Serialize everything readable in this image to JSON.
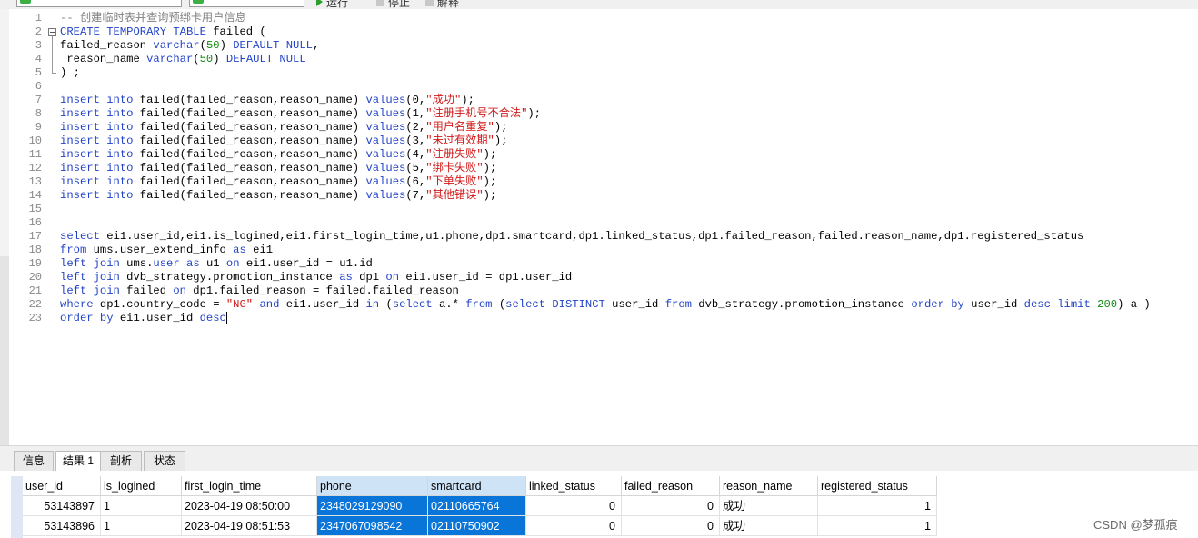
{
  "toolbar": {
    "run_label": "运行",
    "stop_label": "停止",
    "explain_label": "解释"
  },
  "editor": {
    "lines": [
      {
        "n": "1",
        "segs": [
          {
            "t": "-- 创建临时表并查询预绑卡用户信息",
            "c": "c"
          }
        ]
      },
      {
        "n": "2",
        "segs": [
          {
            "t": "CREATE TEMPORARY TABLE",
            "c": "k"
          },
          {
            "t": " failed (",
            "c": ""
          }
        ]
      },
      {
        "n": "3",
        "segs": [
          {
            "t": "failed_reason ",
            "c": ""
          },
          {
            "t": "varchar",
            "c": "k"
          },
          {
            "t": "(",
            "c": ""
          },
          {
            "t": "50",
            "c": "n"
          },
          {
            "t": ") ",
            "c": ""
          },
          {
            "t": "DEFAULT NULL",
            "c": "k"
          },
          {
            "t": ",",
            "c": ""
          }
        ]
      },
      {
        "n": "4",
        "segs": [
          {
            "t": " reason_name ",
            "c": ""
          },
          {
            "t": "varchar",
            "c": "k"
          },
          {
            "t": "(",
            "c": ""
          },
          {
            "t": "50",
            "c": "n"
          },
          {
            "t": ") ",
            "c": ""
          },
          {
            "t": "DEFAULT NULL",
            "c": "k"
          }
        ]
      },
      {
        "n": "5",
        "segs": [
          {
            "t": ") ;",
            "c": ""
          }
        ]
      },
      {
        "n": "6",
        "segs": []
      },
      {
        "n": "7",
        "segs": [
          {
            "t": "insert into",
            "c": "k"
          },
          {
            "t": " failed(failed_reason,reason_name) ",
            "c": ""
          },
          {
            "t": "values",
            "c": "k"
          },
          {
            "t": "(0,",
            "c": ""
          },
          {
            "t": "\"成功\"",
            "c": "s"
          },
          {
            "t": ");",
            "c": ""
          }
        ]
      },
      {
        "n": "8",
        "segs": [
          {
            "t": "insert into",
            "c": "k"
          },
          {
            "t": " failed(failed_reason,reason_name) ",
            "c": ""
          },
          {
            "t": "values",
            "c": "k"
          },
          {
            "t": "(1,",
            "c": ""
          },
          {
            "t": "\"注册手机号不合法\"",
            "c": "s"
          },
          {
            "t": ");",
            "c": ""
          }
        ]
      },
      {
        "n": "9",
        "segs": [
          {
            "t": "insert into",
            "c": "k"
          },
          {
            "t": " failed(failed_reason,reason_name) ",
            "c": ""
          },
          {
            "t": "values",
            "c": "k"
          },
          {
            "t": "(2,",
            "c": ""
          },
          {
            "t": "\"用户名重复\"",
            "c": "s"
          },
          {
            "t": ");",
            "c": ""
          }
        ]
      },
      {
        "n": "10",
        "segs": [
          {
            "t": "insert into",
            "c": "k"
          },
          {
            "t": " failed(failed_reason,reason_name) ",
            "c": ""
          },
          {
            "t": "values",
            "c": "k"
          },
          {
            "t": "(3,",
            "c": ""
          },
          {
            "t": "\"未过有效期\"",
            "c": "s"
          },
          {
            "t": ");",
            "c": ""
          }
        ]
      },
      {
        "n": "11",
        "segs": [
          {
            "t": "insert into",
            "c": "k"
          },
          {
            "t": " failed(failed_reason,reason_name) ",
            "c": ""
          },
          {
            "t": "values",
            "c": "k"
          },
          {
            "t": "(4,",
            "c": ""
          },
          {
            "t": "\"注册失败\"",
            "c": "s"
          },
          {
            "t": ");",
            "c": ""
          }
        ]
      },
      {
        "n": "12",
        "segs": [
          {
            "t": "insert into",
            "c": "k"
          },
          {
            "t": " failed(failed_reason,reason_name) ",
            "c": ""
          },
          {
            "t": "values",
            "c": "k"
          },
          {
            "t": "(5,",
            "c": ""
          },
          {
            "t": "\"绑卡失败\"",
            "c": "s"
          },
          {
            "t": ");",
            "c": ""
          }
        ]
      },
      {
        "n": "13",
        "segs": [
          {
            "t": "insert into",
            "c": "k"
          },
          {
            "t": " failed(failed_reason,reason_name) ",
            "c": ""
          },
          {
            "t": "values",
            "c": "k"
          },
          {
            "t": "(6,",
            "c": ""
          },
          {
            "t": "\"下单失败\"",
            "c": "s"
          },
          {
            "t": ");",
            "c": ""
          }
        ]
      },
      {
        "n": "14",
        "segs": [
          {
            "t": "insert into",
            "c": "k"
          },
          {
            "t": " failed(failed_reason,reason_name) ",
            "c": ""
          },
          {
            "t": "values",
            "c": "k"
          },
          {
            "t": "(7,",
            "c": ""
          },
          {
            "t": "\"其他错误\"",
            "c": "s"
          },
          {
            "t": ");",
            "c": ""
          }
        ]
      },
      {
        "n": "15",
        "segs": []
      },
      {
        "n": "16",
        "segs": []
      },
      {
        "n": "17",
        "segs": [
          {
            "t": "select",
            "c": "k"
          },
          {
            "t": " ei1.user_id,ei1.is_logined,ei1.first_login_time,u1.phone,dp1.smartcard,dp1.linked_status,dp1.failed_reason,failed.reason_name,dp1.registered_status",
            "c": ""
          }
        ]
      },
      {
        "n": "18",
        "segs": [
          {
            "t": "from",
            "c": "k"
          },
          {
            "t": " ums.user_extend_info ",
            "c": ""
          },
          {
            "t": "as",
            "c": "k"
          },
          {
            "t": " ei1",
            "c": ""
          }
        ]
      },
      {
        "n": "19",
        "segs": [
          {
            "t": "left join",
            "c": "k"
          },
          {
            "t": " ums.",
            "c": ""
          },
          {
            "t": "user",
            "c": "k"
          },
          {
            "t": " ",
            "c": ""
          },
          {
            "t": "as",
            "c": "k"
          },
          {
            "t": " u1 ",
            "c": ""
          },
          {
            "t": "on",
            "c": "k"
          },
          {
            "t": " ei1.user_id = u1.id",
            "c": ""
          }
        ]
      },
      {
        "n": "20",
        "segs": [
          {
            "t": "left join",
            "c": "k"
          },
          {
            "t": " dvb_strategy.promotion_instance ",
            "c": ""
          },
          {
            "t": "as",
            "c": "k"
          },
          {
            "t": " dp1 ",
            "c": ""
          },
          {
            "t": "on",
            "c": "k"
          },
          {
            "t": " ei1.user_id = dp1.user_id",
            "c": ""
          }
        ]
      },
      {
        "n": "21",
        "segs": [
          {
            "t": "left join",
            "c": "k"
          },
          {
            "t": " failed ",
            "c": ""
          },
          {
            "t": "on",
            "c": "k"
          },
          {
            "t": " dp1.failed_reason = failed.failed_reason",
            "c": ""
          }
        ]
      },
      {
        "n": "22",
        "segs": [
          {
            "t": "where",
            "c": "k"
          },
          {
            "t": " dp1.country_code = ",
            "c": ""
          },
          {
            "t": "\"NG\"",
            "c": "s"
          },
          {
            "t": " ",
            "c": ""
          },
          {
            "t": "and",
            "c": "k"
          },
          {
            "t": " ei1.user_id ",
            "c": ""
          },
          {
            "t": "in",
            "c": "k"
          },
          {
            "t": " (",
            "c": ""
          },
          {
            "t": "select",
            "c": "k"
          },
          {
            "t": " a.* ",
            "c": ""
          },
          {
            "t": "from",
            "c": "k"
          },
          {
            "t": " (",
            "c": ""
          },
          {
            "t": "select DISTINCT",
            "c": "k"
          },
          {
            "t": " user_id ",
            "c": ""
          },
          {
            "t": "from",
            "c": "k"
          },
          {
            "t": " dvb_strategy.promotion_instance ",
            "c": ""
          },
          {
            "t": "order by",
            "c": "k"
          },
          {
            "t": " user_id ",
            "c": ""
          },
          {
            "t": "desc limit",
            "c": "k"
          },
          {
            "t": " ",
            "c": ""
          },
          {
            "t": "200",
            "c": "n"
          },
          {
            "t": ") a )",
            "c": ""
          }
        ]
      },
      {
        "n": "23",
        "segs": [
          {
            "t": "order by",
            "c": "k"
          },
          {
            "t": " ei1.user_id ",
            "c": ""
          },
          {
            "t": "desc",
            "c": "k"
          }
        ]
      }
    ]
  },
  "result_tabs": [
    {
      "label": "信息",
      "active": false
    },
    {
      "label": "结果 1",
      "active": true
    },
    {
      "label": "剖析",
      "active": false
    },
    {
      "label": "状态",
      "active": false
    }
  ],
  "grid": {
    "columns": [
      "user_id",
      "is_logined",
      "first_login_time",
      "phone",
      "smartcard",
      "linked_status",
      "failed_reason",
      "reason_name",
      "registered_status"
    ],
    "selected_columns": [
      "phone",
      "smartcard"
    ],
    "rows": [
      [
        "53143897",
        "1",
        "2023-04-19 08:50:00",
        "2348029129090",
        "02110665764",
        "0",
        "0",
        "成功",
        "1"
      ],
      [
        "53143896",
        "1",
        "2023-04-19 08:51:53",
        "2347067098542",
        "02110750902",
        "0",
        "0",
        "成功",
        "1"
      ]
    ]
  },
  "watermark": "CSDN @梦孤痕"
}
